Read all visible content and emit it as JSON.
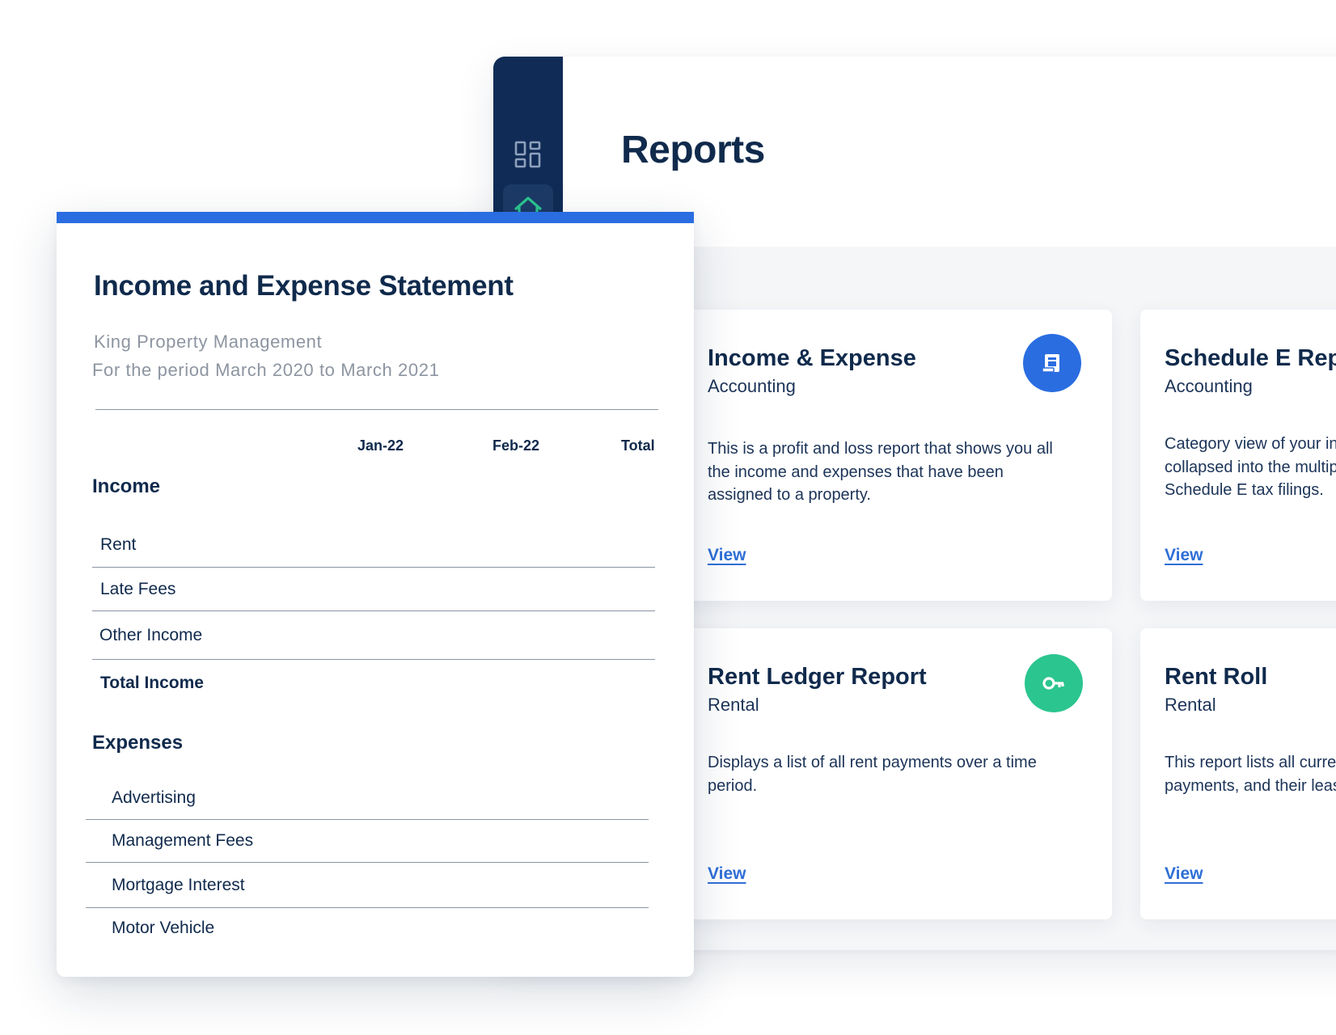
{
  "app": {
    "page_title": "Reports",
    "sidebar": {
      "items": [
        {
          "icon": "dashboard-icon"
        },
        {
          "icon": "home-icon",
          "accent": "#2bc58f"
        }
      ]
    },
    "cards": [
      {
        "title": "Income & Expense",
        "category": "Accounting",
        "description": "This is a profit and loss report that shows you all the income and expenses that have been assigned to a property.",
        "link": "View",
        "icon": "receipt-icon",
        "icon_color": "#2a6de1"
      },
      {
        "title": "Schedule E Report",
        "category": "Accounting",
        "description": "Category view of your income and expenses collapsed into the multiple categories for Schedule E tax filings.",
        "link": "View"
      },
      {
        "title": "Rent Ledger Report",
        "category": "Rental",
        "description": "Displays a list of all rent payments over a time period.",
        "link": "View",
        "icon": "key-icon",
        "icon_color": "#2bc58f"
      },
      {
        "title": "Rent Roll",
        "category": "Rental",
        "description": "This report lists all current tenants, their rent payments, and their lease expiration date.",
        "link": "View"
      }
    ]
  },
  "statement": {
    "title": "Income and Expense Statement",
    "company": "King Property Management",
    "period": "For the period March 2020 to March 2021",
    "columns": [
      "Jan-22",
      "Feb-22",
      "Total"
    ],
    "income": {
      "heading": "Income",
      "rows": [
        "Rent",
        "Late Fees",
        "Other Income"
      ],
      "total_label": "Total Income"
    },
    "expenses": {
      "heading": "Expenses",
      "rows": [
        "Advertising",
        "Management Fees",
        "Mortgage Interest",
        "Motor Vehicle"
      ]
    },
    "accent_color": "#2a6de1"
  }
}
